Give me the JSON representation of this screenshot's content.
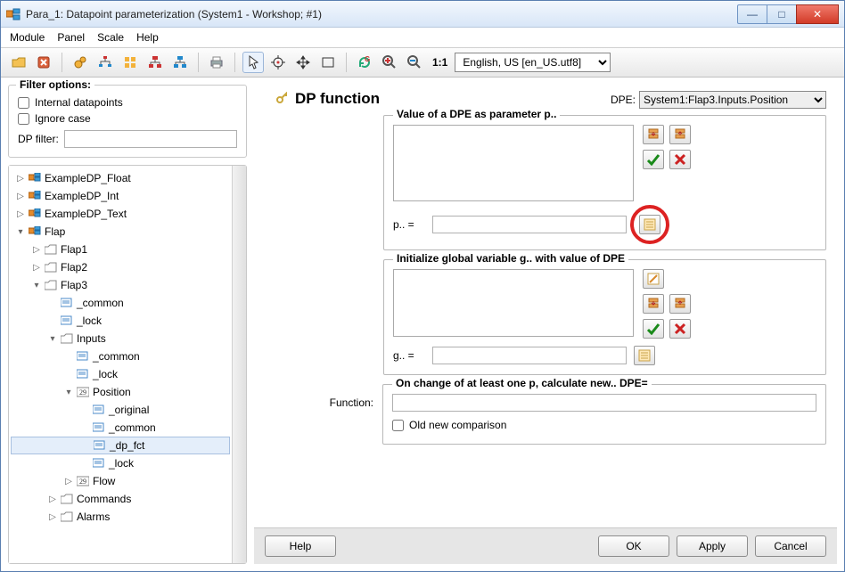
{
  "window": {
    "title": "Para_1: Datapoint parameterization (System1 - Workshop; #1)"
  },
  "menu": [
    "Module",
    "Panel",
    "Scale",
    "Help"
  ],
  "toolbar": {
    "scale": "1:1",
    "lang": "English, US [en_US.utf8]"
  },
  "filter": {
    "legend": "Filter options:",
    "internal": "Internal datapoints",
    "ignore": "Ignore case",
    "dpfilter_label": "DP filter:",
    "dpfilter_value": ""
  },
  "tree": [
    {
      "d": 0,
      "e": "▷",
      "icon": "dp",
      "label": "ExampleDP_Float"
    },
    {
      "d": 0,
      "e": "▷",
      "icon": "dp",
      "label": "ExampleDP_Int"
    },
    {
      "d": 0,
      "e": "▷",
      "icon": "dp",
      "label": "ExampleDP_Text"
    },
    {
      "d": 0,
      "e": "▾",
      "icon": "dp",
      "label": "Flap"
    },
    {
      "d": 1,
      "e": "▷",
      "icon": "folder",
      "label": "Flap1"
    },
    {
      "d": 1,
      "e": "▷",
      "icon": "folder",
      "label": "Flap2"
    },
    {
      "d": 1,
      "e": "▾",
      "icon": "folder",
      "label": "Flap3"
    },
    {
      "d": 2,
      "e": "",
      "icon": "leaf",
      "label": "_common"
    },
    {
      "d": 2,
      "e": "",
      "icon": "leaf",
      "label": "_lock"
    },
    {
      "d": 2,
      "e": "▾",
      "icon": "folder",
      "label": "Inputs"
    },
    {
      "d": 3,
      "e": "",
      "icon": "leaf",
      "label": "_common"
    },
    {
      "d": 3,
      "e": "",
      "icon": "leaf",
      "label": "_lock"
    },
    {
      "d": 3,
      "e": "▾",
      "icon": "num",
      "label": "Position"
    },
    {
      "d": 4,
      "e": "",
      "icon": "leaf",
      "label": "_original"
    },
    {
      "d": 4,
      "e": "",
      "icon": "leaf",
      "label": "_common"
    },
    {
      "d": 4,
      "e": "",
      "icon": "leaf",
      "label": "_dp_fct",
      "sel": true
    },
    {
      "d": 4,
      "e": "",
      "icon": "leaf",
      "label": "_lock"
    },
    {
      "d": 3,
      "e": "▷",
      "icon": "num",
      "label": "Flow"
    },
    {
      "d": 2,
      "e": "▷",
      "icon": "folder",
      "label": "Commands"
    },
    {
      "d": 2,
      "e": "▷",
      "icon": "folder",
      "label": "Alarms"
    }
  ],
  "right": {
    "heading": "DP function",
    "dpe_label": "DPE:",
    "dpe_value": "System1:Flap3.Inputs.Position",
    "group_p_legend": "Value of a DPE as parameter p..",
    "p_lbl": "p.. =",
    "group_g_legend": "Initialize global variable g.. with value of DPE",
    "g_lbl": "g.. =",
    "group_f_legend": "On change of at least one p, calculate new.. DPE=",
    "func_label": "Function:",
    "oldnew": "Old new comparison"
  },
  "buttons": {
    "help": "Help",
    "ok": "OK",
    "apply": "Apply",
    "cancel": "Cancel"
  }
}
